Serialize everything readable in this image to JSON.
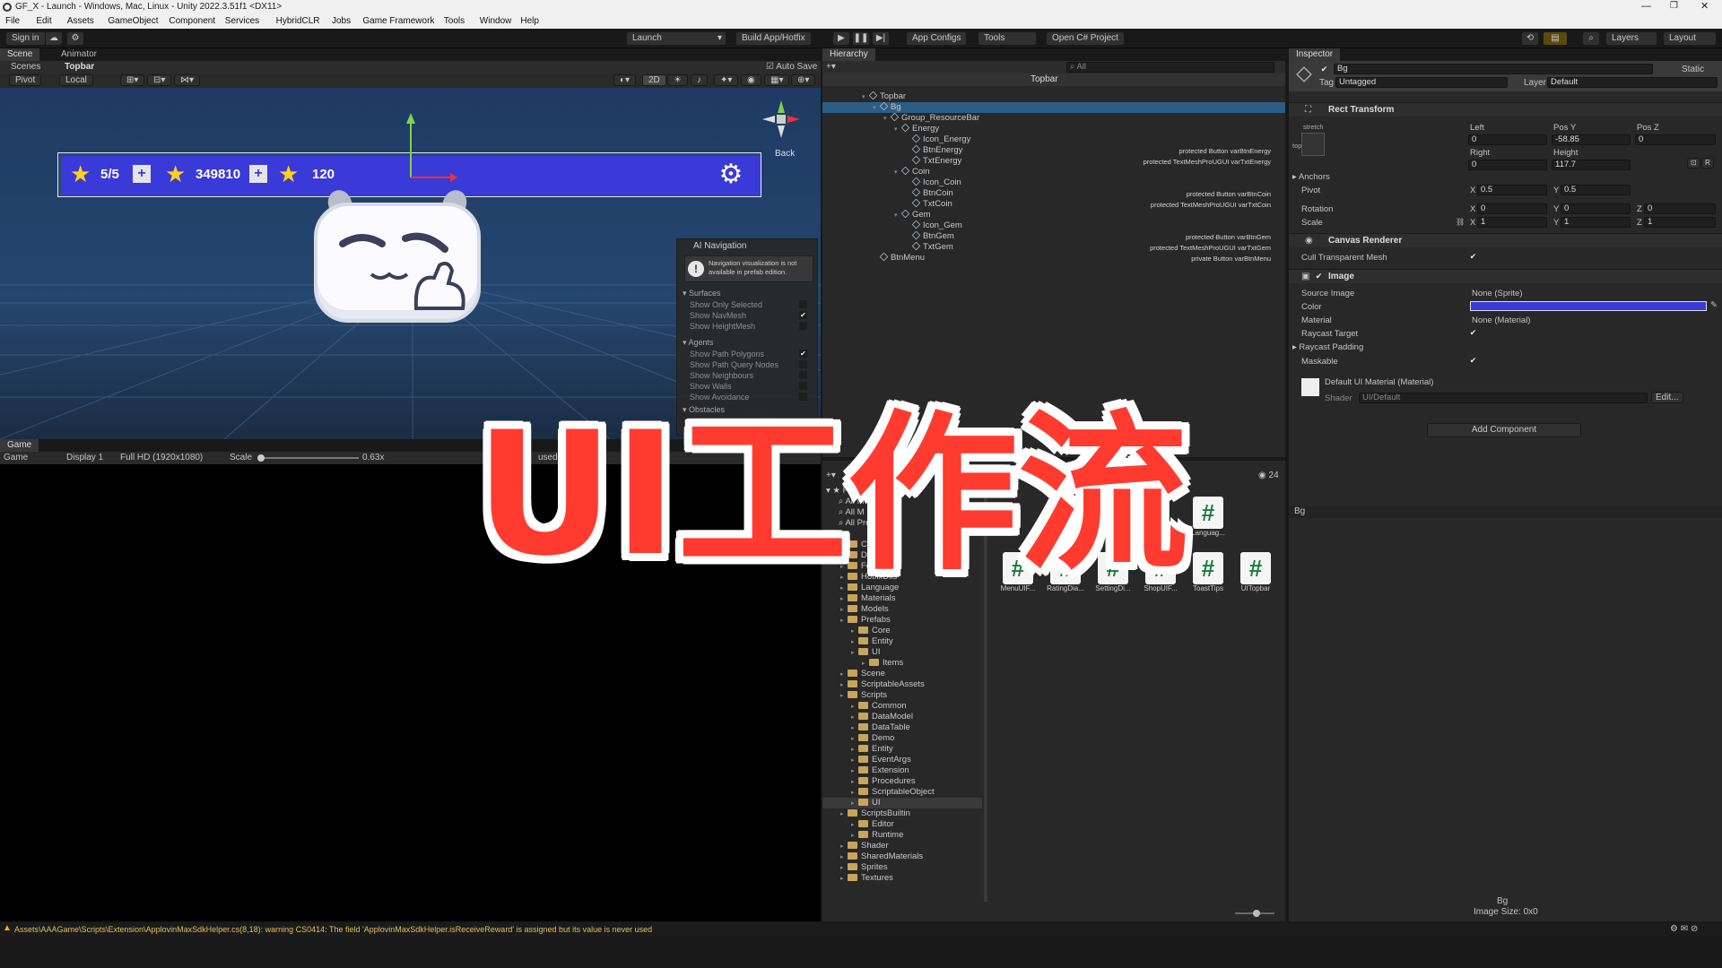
{
  "window": {
    "title": "GF_X - Launch - Windows, Mac, Linux - Unity 2022.3.51f1 <DX11>"
  },
  "menu": [
    "File",
    "Edit",
    "Assets",
    "GameObject",
    "Component",
    "Services",
    "HybridCLR",
    "Jobs",
    "Game Framework",
    "Tools",
    "Window",
    "Help"
  ],
  "toolbar": {
    "sign_in": "Sign in",
    "launch": "Launch",
    "build": "Build App/Hotfix",
    "app_configs": "App Configs",
    "tools": "Tools",
    "open_cs": "Open C# Project",
    "layers": "Layers",
    "layout": "Layout"
  },
  "scene": {
    "tabs": [
      "Scene",
      "Animator"
    ],
    "auto_save": "Auto Save",
    "crumb_scenes": "Scenes",
    "crumb_prefab": "Topbar",
    "pivot": "Pivot",
    "local": "Local",
    "btn_2d": "2D",
    "back": "Back",
    "topbar": {
      "energy": "5/5",
      "coin": "349810",
      "gem": "120"
    }
  },
  "ai_nav": {
    "title": "AI Navigation",
    "warning": "Navigation visualization is not available in prefab edition.",
    "surfaces": "Surfaces",
    "surface_items": [
      "Show Only Selected",
      "Show NavMesh",
      "Show HeightMesh"
    ],
    "agents": "Agents",
    "agent_items": [
      "Show Path Polygons",
      "Show Path Query Nodes",
      "Show Neighbours",
      "Show Walls",
      "Show Avoidance"
    ],
    "obstacles": "Obstacles"
  },
  "game": {
    "tab": "Game",
    "mode": "Game",
    "display": "Display 1",
    "res": "Full HD (1920x1080)",
    "scale_label": "Scale",
    "scale": "0.63x",
    "used": "used"
  },
  "hierarchy": {
    "tab": "Hierarchy",
    "search": "All",
    "prefab": "Topbar",
    "rows": [
      {
        "name": "Topbar",
        "d": 0
      },
      {
        "name": "Bg",
        "d": 1
      },
      {
        "name": "Group_ResourceBar",
        "d": 2
      },
      {
        "name": "Energy",
        "d": 3
      },
      {
        "name": "Icon_Energy",
        "d": 4
      },
      {
        "name": "BtnEnergy",
        "d": 4,
        "hint": "protected Button varBtnEnergy"
      },
      {
        "name": "TxtEnergy",
        "d": 4,
        "hint": "protected TextMeshProUGUI varTxtEnergy"
      },
      {
        "name": "Coin",
        "d": 3
      },
      {
        "name": "Icon_Coin",
        "d": 4
      },
      {
        "name": "BtnCoin",
        "d": 4,
        "hint": "protected Button varBtnCoin"
      },
      {
        "name": "TxtCoin",
        "d": 4,
        "hint": "protected TextMeshProUGUI varTxtCoin"
      },
      {
        "name": "Gem",
        "d": 3
      },
      {
        "name": "Icon_Gem",
        "d": 4
      },
      {
        "name": "BtnGem",
        "d": 4,
        "hint": "protected Button varBtnGem"
      },
      {
        "name": "TxtGem",
        "d": 4,
        "hint": "protected TextMeshProUGUI varTxtGem"
      },
      {
        "name": "BtnMenu",
        "d": 1,
        "hint": "private Button varBtnMenu"
      }
    ]
  },
  "project": {
    "count": "24",
    "favorites": "Favo",
    "fav_items": [
      "All M",
      "All M",
      "All Pre"
    ],
    "folders": [
      {
        "name": "Confi",
        "d": 1
      },
      {
        "name": "DataTable",
        "d": 1
      },
      {
        "name": "Font",
        "d": 1
      },
      {
        "name": "HotfixDlls",
        "d": 1
      },
      {
        "name": "Language",
        "d": 1
      },
      {
        "name": "Materials",
        "d": 1
      },
      {
        "name": "Models",
        "d": 1
      },
      {
        "name": "Prefabs",
        "d": 1
      },
      {
        "name": "Core",
        "d": 2
      },
      {
        "name": "Entity",
        "d": 2
      },
      {
        "name": "UI",
        "d": 2
      },
      {
        "name": "Items",
        "d": 3
      },
      {
        "name": "Scene",
        "d": 1
      },
      {
        "name": "ScriptableAssets",
        "d": 1
      },
      {
        "name": "Scripts",
        "d": 1
      },
      {
        "name": "Common",
        "d": 2
      },
      {
        "name": "DataModel",
        "d": 2
      },
      {
        "name": "DataTable",
        "d": 2
      },
      {
        "name": "Demo",
        "d": 2
      },
      {
        "name": "Entity",
        "d": 2
      },
      {
        "name": "EventArgs",
        "d": 2
      },
      {
        "name": "Extension",
        "d": 2
      },
      {
        "name": "Procedures",
        "d": 2
      },
      {
        "name": "ScriptableObject",
        "d": 2
      },
      {
        "name": "UI",
        "d": 2
      },
      {
        "name": "ScriptsBuiltin",
        "d": 1
      },
      {
        "name": "Editor",
        "d": 2
      },
      {
        "name": "Runtime",
        "d": 2
      },
      {
        "name": "Shader",
        "d": 1
      },
      {
        "name": "SharedMaterials",
        "d": 1
      },
      {
        "name": "Sprites",
        "d": 1
      },
      {
        "name": "Textures",
        "d": 1
      }
    ],
    "assets_row1": [
      "Languag..."
    ],
    "assets_row2": [
      "MenuUIF...",
      "RatingDia...",
      "SettingDi...",
      "ShopUIF...",
      "ToastTips",
      "UITopbar"
    ]
  },
  "inspector": {
    "tab": "Inspector",
    "name": "Bg",
    "static": "Static",
    "tag_label": "Tag",
    "tag": "Untagged",
    "layer_label": "Layer",
    "layer": "Default",
    "rect": {
      "title": "Rect Transform",
      "stretch": "stretch",
      "top": "top",
      "left_l": "Left",
      "posy_l": "Pos Y",
      "posz_l": "Pos Z",
      "left": "0",
      "posy": "-58.85",
      "posz": "0",
      "right_l": "Right",
      "height_l": "Height",
      "right": "0",
      "height": "117.7",
      "anchors": "Anchors",
      "pivot": "Pivot",
      "pivot_x": "0.5",
      "pivot_y": "0.5",
      "rotation": "Rotation",
      "rot_x": "0",
      "rot_y": "0",
      "rot_z": "0",
      "scale": "Scale",
      "sc_x": "1",
      "sc_y": "1",
      "sc_z": "1",
      "btn_r": "R"
    },
    "canvas": {
      "title": "Canvas Renderer",
      "cull": "Cull Transparent Mesh"
    },
    "image": {
      "title": "Image",
      "source_l": "Source Image",
      "source": "None (Sprite)",
      "color_l": "Color",
      "color": "#3a3ad8",
      "material_l": "Material",
      "material": "None (Material)",
      "raycast": "Raycast Target",
      "padding": "Raycast Padding",
      "maskable": "Maskable"
    },
    "mat": {
      "title": "Default UI Material (Material)",
      "shader_l": "Shader",
      "shader": "UI/Default",
      "edit": "Edit..."
    },
    "add": "Add Component",
    "preview_name": "Bg",
    "preview_caption": "Bg",
    "preview_size": "Image Size: 0x0"
  },
  "console": "Assets\\AAAGame\\Scripts\\Extension\\ApplovinMaxSdkHelper.cs(8,18): warning CS0414: The field 'ApplovinMaxSdkHelper.isReceiveReward' is assigned but its value is never used",
  "overlay": {
    "title": "UI工作流"
  }
}
